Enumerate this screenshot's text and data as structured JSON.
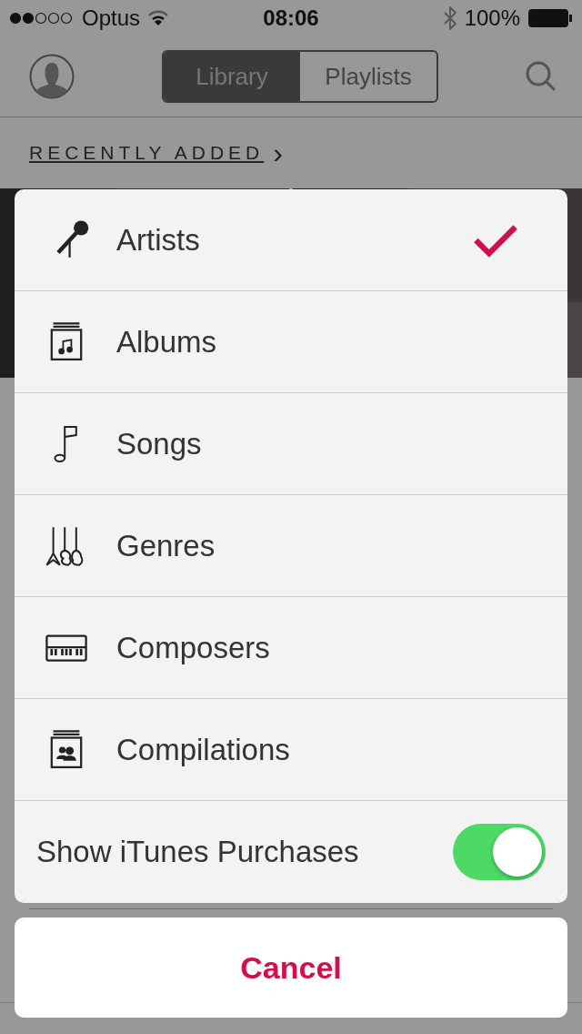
{
  "status_bar": {
    "carrier": "Optus",
    "time": "08:06",
    "battery": "100%"
  },
  "nav": {
    "segments": [
      {
        "label": "Library",
        "selected": true
      },
      {
        "label": "Playlists",
        "selected": false
      }
    ]
  },
  "section": {
    "title": "RECENTLY ADDED",
    "chevron": "›"
  },
  "sheet": {
    "items": [
      {
        "label": "Artists",
        "selected": true
      },
      {
        "label": "Albums",
        "selected": false
      },
      {
        "label": "Songs",
        "selected": false
      },
      {
        "label": "Genres",
        "selected": false
      },
      {
        "label": "Composers",
        "selected": false
      },
      {
        "label": "Compilations",
        "selected": false
      }
    ],
    "toggle": {
      "label": "Show iTunes Purchases",
      "on": true
    },
    "cancel": "Cancel"
  }
}
